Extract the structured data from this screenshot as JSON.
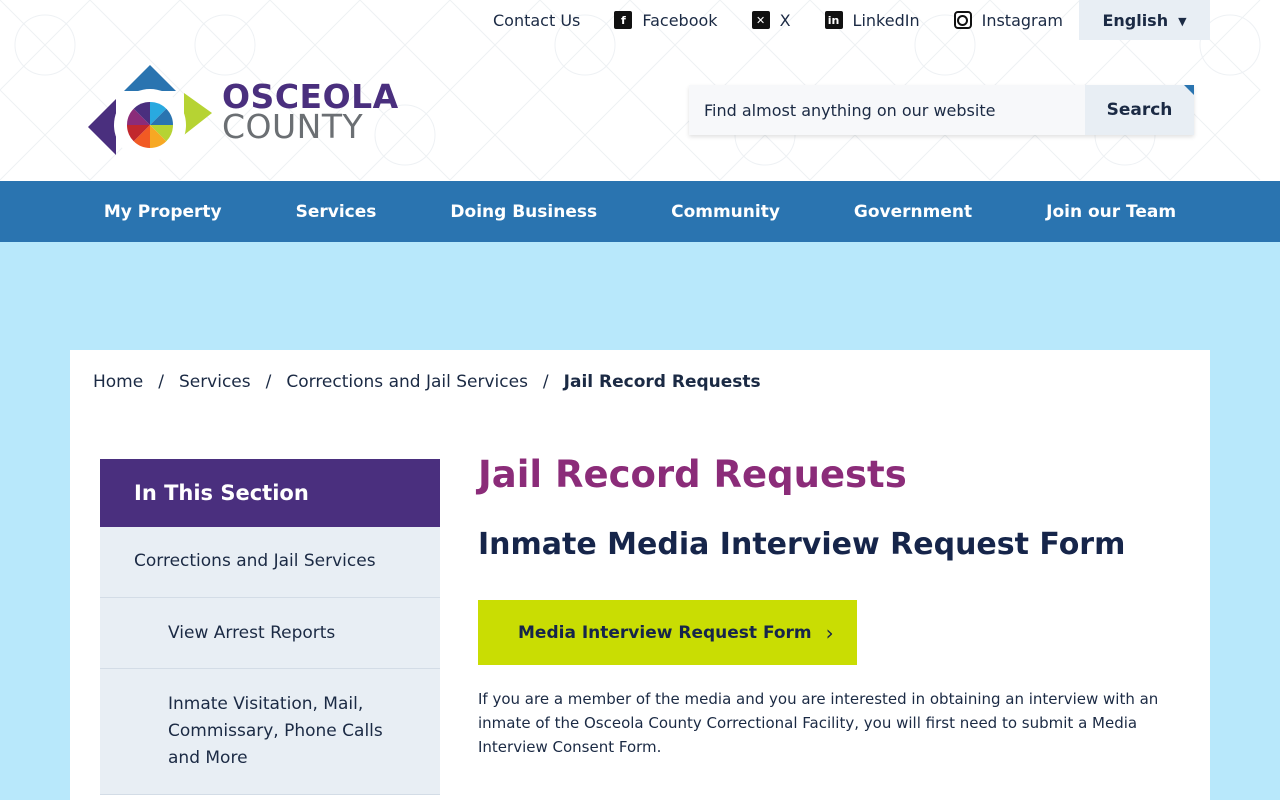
{
  "utility": {
    "contact": "Contact Us",
    "facebook": "Facebook",
    "x": "X",
    "linkedin": "LinkedIn",
    "instagram": "Instagram",
    "language": "English"
  },
  "logo": {
    "line1": "OSCEOLA",
    "line2": "COUNTY"
  },
  "search": {
    "placeholder": "Find almost anything on our website",
    "button": "Search"
  },
  "nav": [
    "My Property",
    "Services",
    "Doing Business",
    "Community",
    "Government",
    "Join our Team"
  ],
  "breadcrumb": {
    "items": [
      "Home",
      "Services",
      "Corrections and Jail Services"
    ],
    "separator": "/",
    "current": "Jail Record Requests"
  },
  "sidebar": {
    "heading": "In This Section",
    "items": [
      "Corrections and Jail Services",
      "View Arrest Reports",
      "Inmate Visitation, Mail, Commissary, Phone Calls and More"
    ]
  },
  "main": {
    "title": "Jail Record Requests",
    "subtitle": "Inmate Media Interview Request Form",
    "cta": "Media Interview Request Form",
    "paragraph": "If you are a member of the media and you are interested in obtaining an interview with an inmate of the Osceola County Correctional Facility, you will first need to submit a Media Interview Consent Form."
  },
  "colors": {
    "nav": "#2a74b0",
    "band": "#b8e8fb",
    "sidebar_head": "#4a2f7e",
    "title": "#8b2c79",
    "cta": "#c9dd03"
  },
  "icons": [
    "facebook-icon",
    "x-icon",
    "linkedin-icon",
    "instagram-icon",
    "chevron-down-icon",
    "chevron-right-icon"
  ]
}
